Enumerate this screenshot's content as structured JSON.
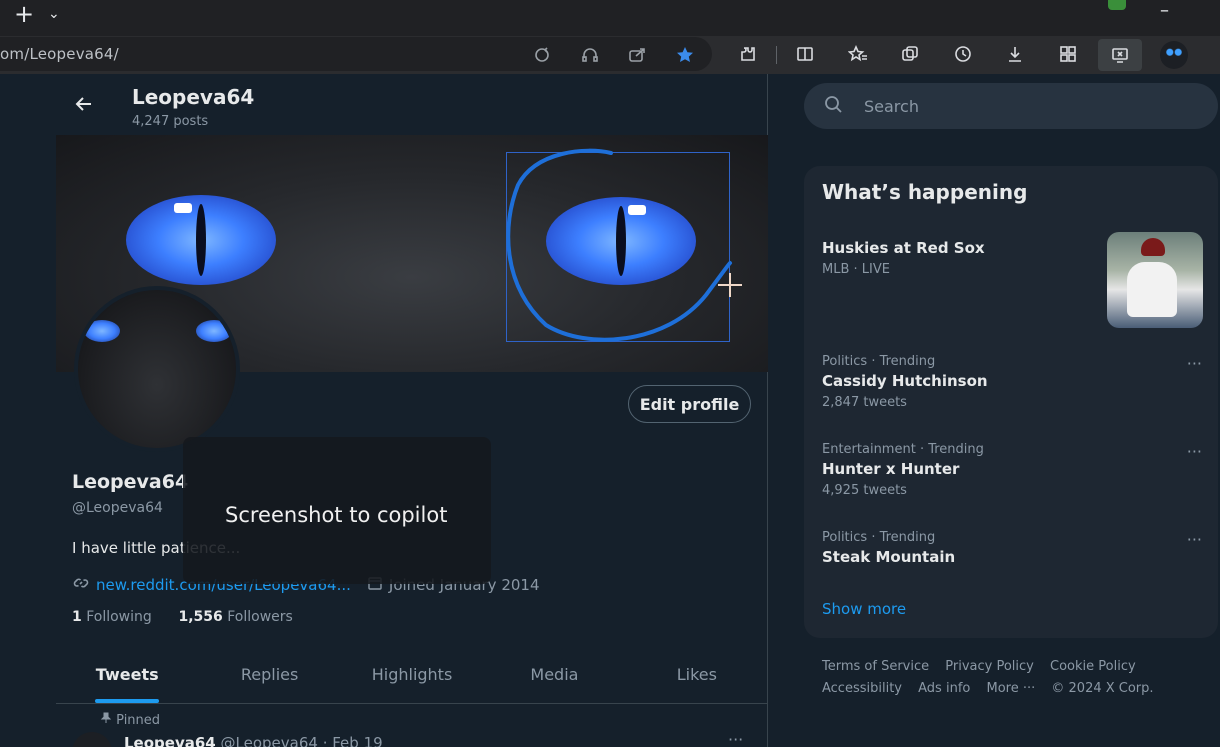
{
  "browser": {
    "address": "om/Leopeva64/",
    "new_tab_glyph": "+",
    "tab_list_glyph": "⌄",
    "minimize_glyph": "–"
  },
  "header": {
    "name": "Leopeva64",
    "posts": "4,247 posts"
  },
  "profile": {
    "name": "Leopeva64",
    "handle": "@Leopeva64",
    "bio": "I have little patience...",
    "link": "new.reddit.com/user/Leopeva64...",
    "joined": "Joined January 2014",
    "following_count": "1",
    "following_label": "Following",
    "followers_count": "1,556",
    "followers_label": "Followers",
    "edit_label": "Edit profile"
  },
  "tabs": [
    "Tweets",
    "Replies",
    "Highlights",
    "Media",
    "Likes"
  ],
  "pinned": {
    "label": "Pinned",
    "name": "Leopeva64",
    "handle": "@Leopeva64",
    "date": "· Feb 19",
    "more_glyph": "···"
  },
  "toast": {
    "text": "Screenshot to copilot"
  },
  "search": {
    "placeholder": "Search"
  },
  "whats_happening": {
    "title": "What’s happening",
    "trends": [
      {
        "category": "Huskies at Red Sox",
        "meta": "MLB · LIVE"
      },
      {
        "category": "Politics · Trending",
        "title": "Cassidy Hutchinson",
        "count": "2,847 tweets",
        "more": "···"
      },
      {
        "category": "Entertainment · Trending",
        "title": "Hunter x Hunter",
        "count": "4,925 tweets",
        "more": "···"
      },
      {
        "category": "Politics · Trending",
        "title": "Steak Mountain",
        "more": "···"
      }
    ],
    "show_more": "Show more"
  },
  "footer": {
    "line1": [
      "Terms of Service",
      "Privacy Policy",
      "Cookie Policy"
    ],
    "line2": [
      "Accessibility",
      "Ads info",
      "More ···",
      "© 2024 X Corp."
    ]
  },
  "colors": {
    "accent": "#1d9bf0",
    "background": "#15202b",
    "panel": "#1e2732"
  }
}
